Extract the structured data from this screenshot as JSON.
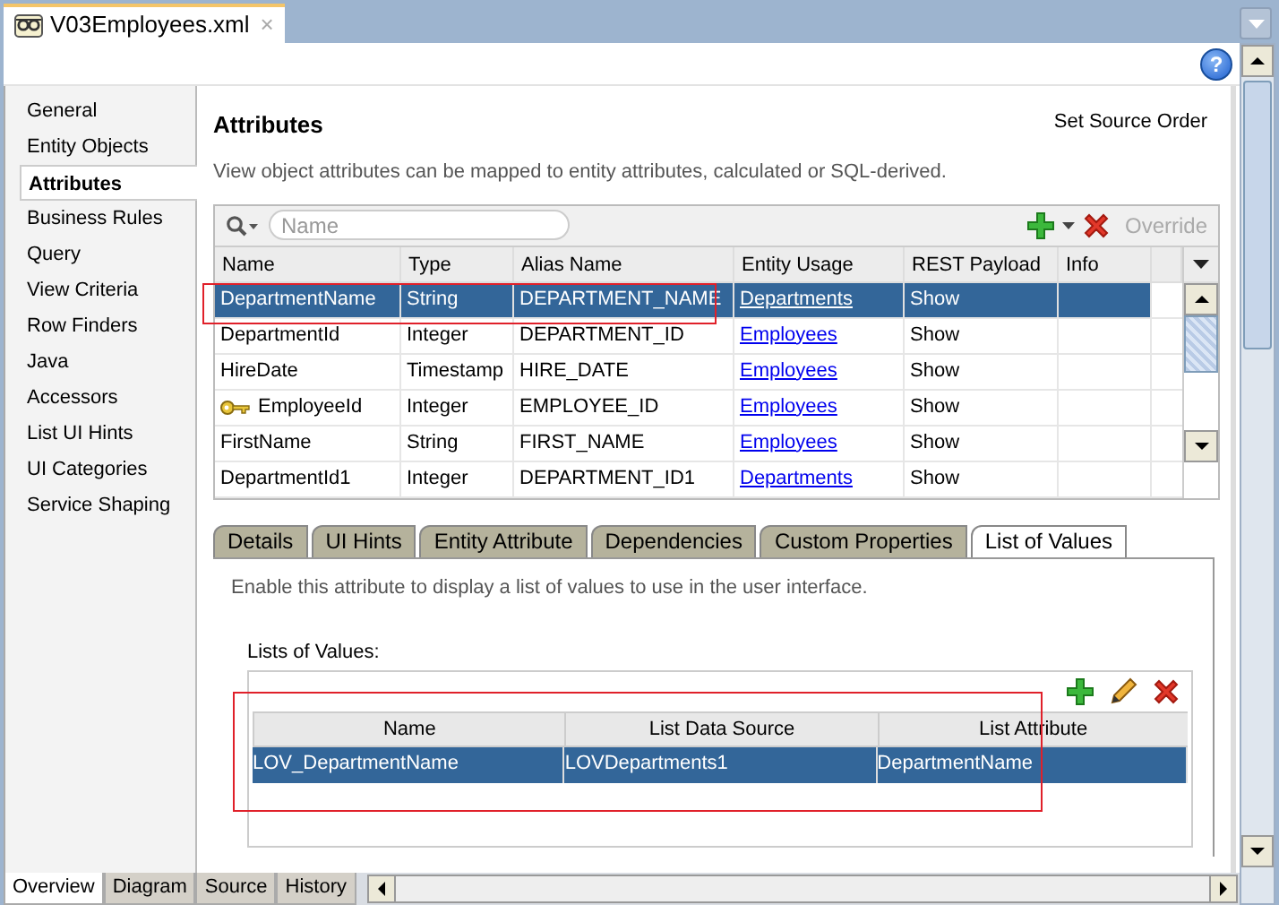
{
  "file_tab": {
    "title": "V03Employees.xml",
    "close": "×",
    "selected": true
  },
  "help": "?",
  "sidebar": {
    "items": [
      {
        "label": "General",
        "selected": false
      },
      {
        "label": "Entity Objects",
        "selected": false
      },
      {
        "label": "Attributes",
        "selected": true
      },
      {
        "label": "Business Rules",
        "selected": false
      },
      {
        "label": "Query",
        "selected": false
      },
      {
        "label": "View Criteria",
        "selected": false
      },
      {
        "label": "Row Finders",
        "selected": false
      },
      {
        "label": "Java",
        "selected": false
      },
      {
        "label": "Accessors",
        "selected": false
      },
      {
        "label": "List UI Hints",
        "selected": false
      },
      {
        "label": "UI Categories",
        "selected": false
      },
      {
        "label": "Service Shaping",
        "selected": false
      }
    ]
  },
  "page": {
    "title": "Attributes",
    "set_source_order": "Set Source Order",
    "description": "View object attributes can be mapped to entity attributes, calculated or SQL-derived."
  },
  "attributes_table": {
    "search": {
      "placeholder": "Name"
    },
    "override": {
      "label": "Override",
      "disabled": true
    },
    "columns": [
      "Name",
      "Type",
      "Alias Name",
      "Entity Usage",
      "REST Payload",
      "Info"
    ],
    "rows": [
      {
        "name": "DepartmentName",
        "type": "String",
        "alias": "DEPARTMENT_NAME",
        "entity_usage": "Departments",
        "rest_payload": "Show",
        "key": false,
        "selected": true,
        "outlined": true
      },
      {
        "name": "DepartmentId",
        "type": "Integer",
        "alias": "DEPARTMENT_ID",
        "entity_usage": "Employees",
        "rest_payload": "Show",
        "key": false,
        "selected": false,
        "outlined": false
      },
      {
        "name": "HireDate",
        "type": "Timestamp",
        "alias": "HIRE_DATE",
        "entity_usage": "Employees",
        "rest_payload": "Show",
        "key": false,
        "selected": false,
        "outlined": false
      },
      {
        "name": "EmployeeId",
        "type": "Integer",
        "alias": "EMPLOYEE_ID",
        "entity_usage": "Employees",
        "rest_payload": "Show",
        "key": true,
        "selected": false,
        "outlined": false
      },
      {
        "name": "FirstName",
        "type": "String",
        "alias": "FIRST_NAME",
        "entity_usage": "Employees",
        "rest_payload": "Show",
        "key": false,
        "selected": false,
        "outlined": false
      },
      {
        "name": "DepartmentId1",
        "type": "Integer",
        "alias": "DEPARTMENT_ID1",
        "entity_usage": "Departments",
        "rest_payload": "Show",
        "key": false,
        "selected": false,
        "outlined": false
      }
    ]
  },
  "detail_tabs": [
    {
      "label": "Details",
      "selected": false
    },
    {
      "label": "UI Hints",
      "selected": false
    },
    {
      "label": "Entity Attribute",
      "selected": false
    },
    {
      "label": "Dependencies",
      "selected": false
    },
    {
      "label": "Custom Properties",
      "selected": false
    },
    {
      "label": "List of Values",
      "selected": true
    }
  ],
  "lov": {
    "description": "Enable this attribute to display a list of values to use in the user interface.",
    "label": "Lists of Values:",
    "outlined": true,
    "columns": [
      "Name",
      "List Data Source",
      "List Attribute"
    ],
    "rows": [
      {
        "cells": [
          "LOV_DepartmentName",
          "LOVDepartments1",
          "DepartmentName"
        ],
        "selected": true
      }
    ]
  },
  "editor_tabs": [
    {
      "label": "Overview",
      "selected": true
    },
    {
      "label": "Diagram",
      "selected": false
    },
    {
      "label": "Source",
      "selected": false
    },
    {
      "label": "History",
      "selected": false
    }
  ]
}
